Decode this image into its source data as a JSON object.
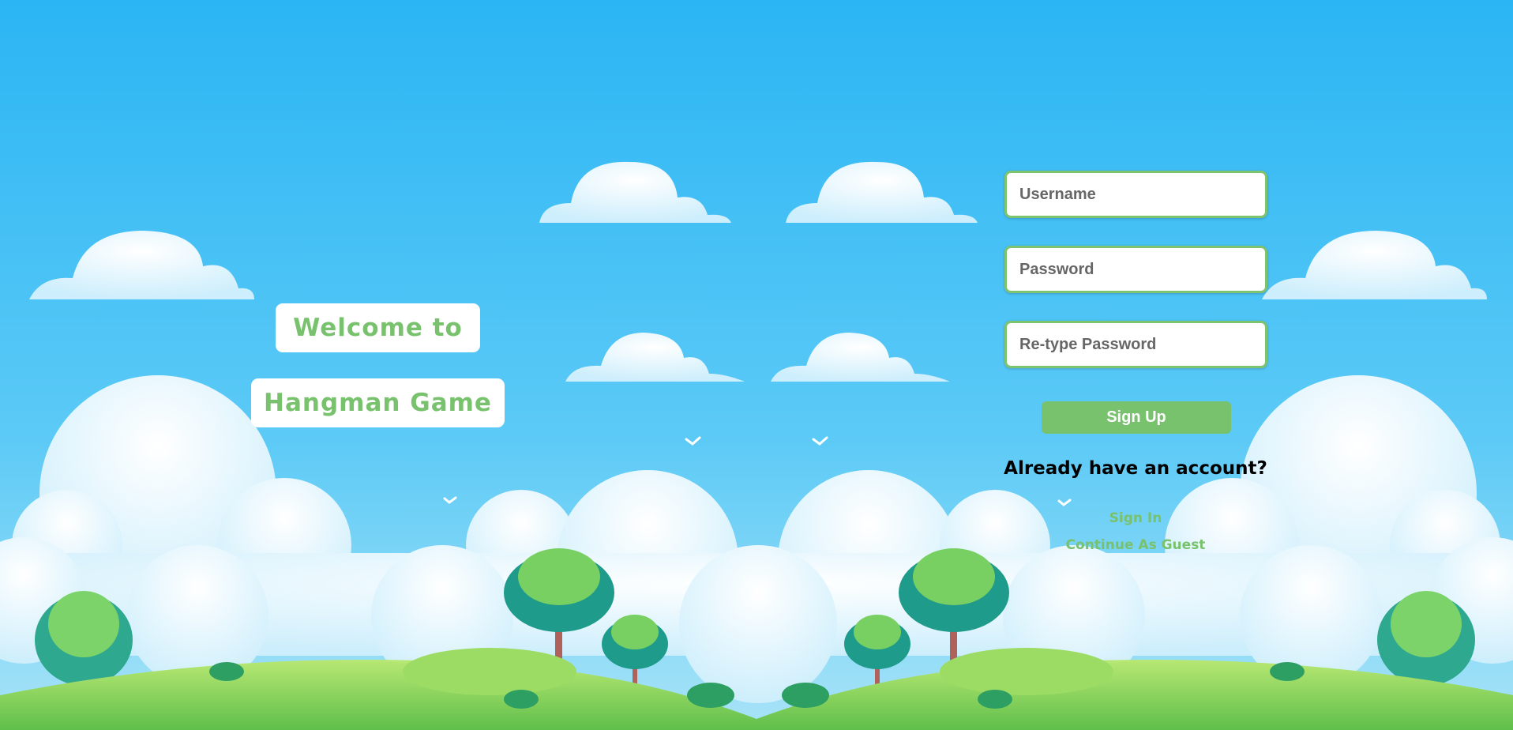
{
  "welcome": {
    "line1": "Welcome to",
    "line2": "Hangman Game"
  },
  "form": {
    "username_placeholder": "Username",
    "password_placeholder": "Password",
    "retype_placeholder": "Re-type Password",
    "signup_label": "Sign Up"
  },
  "account": {
    "question": "Already have an account?",
    "signin_label": "Sign In",
    "guest_label": "Continue As Guest"
  },
  "colors": {
    "accent": "#78c16d",
    "sky_top": "#2bb5f4",
    "sky_bottom": "#7fd6f7",
    "grass": "#8fd35a"
  }
}
